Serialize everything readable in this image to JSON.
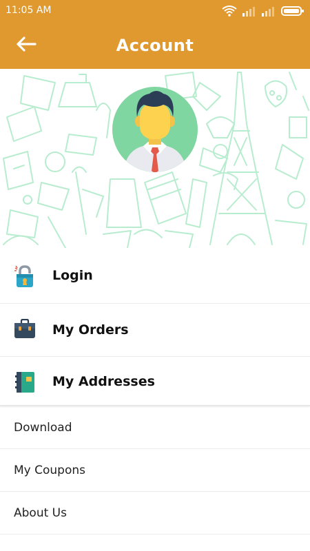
{
  "status_bar": {
    "time": "11:05 AM",
    "icons": [
      "wifi-icon",
      "signal-icon",
      "signal-icon",
      "battery-icon"
    ]
  },
  "toolbar": {
    "title": "Account",
    "back_icon": "arrow-left-icon"
  },
  "colors": {
    "primary": "#E0992F",
    "pattern": "#b7eccf",
    "avatar_bg": "#7fd6a0"
  },
  "primary_menu": [
    {
      "label": "Login",
      "icon": "padlock-icon"
    },
    {
      "label": "My Orders",
      "icon": "briefcase-icon"
    },
    {
      "label": "My Addresses",
      "icon": "address-book-icon"
    }
  ],
  "secondary_menu": [
    {
      "label": "Download"
    },
    {
      "label": "My Coupons"
    },
    {
      "label": "About Us"
    }
  ]
}
